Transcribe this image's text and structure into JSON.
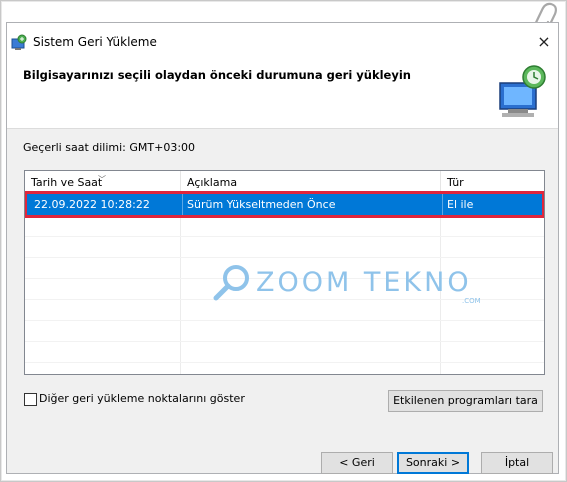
{
  "window": {
    "title": "Sistem Geri Yükleme",
    "close_glyph": "×"
  },
  "header": {
    "title": "Bilgisayarınızı seçili olaydan önceki durumuna geri yükleyin"
  },
  "timezone": {
    "label": "Geçerli saat dilimi: GMT+03:00"
  },
  "table": {
    "columns": [
      "Tarih ve Saat",
      "Açıklama",
      "Tür"
    ],
    "rows": [
      {
        "date": "22.09.2022 10:28:22",
        "description": "Sürüm Yükseltmeden Önce",
        "type": "El ile",
        "selected": true
      }
    ]
  },
  "watermark": {
    "text": "ZOOM TEKNO",
    "sub": ".COM"
  },
  "options": {
    "show_more_label": "Diğer geri yükleme noktalarını göster",
    "show_more_checked": false
  },
  "buttons": {
    "scan_label": "Etkilenen programları tara",
    "back_label": "< Geri",
    "next_label": "Sonraki >",
    "cancel_label": "İptal"
  },
  "colors": {
    "selection": "#0078d7",
    "highlight_border": "#e0263c",
    "watermark": "#8fc3ea"
  },
  "icons": [
    "system-restore-icon",
    "close-icon",
    "restore-monitor-icon",
    "paperclip-icon",
    "search-icon"
  ]
}
